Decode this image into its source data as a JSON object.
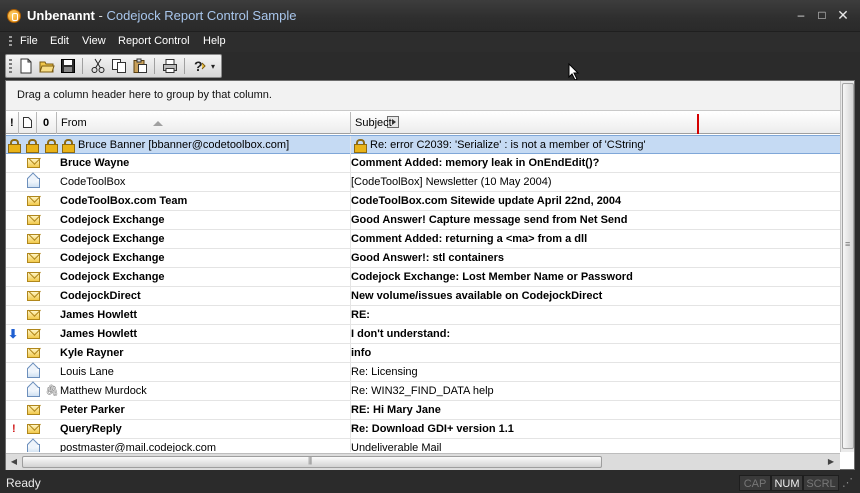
{
  "window": {
    "document_title": "Unbenannt",
    "separator": " - ",
    "app_title": "Codejock Report Control Sample",
    "min_glyph": "–",
    "max_glyph": "□",
    "close_glyph": "✕"
  },
  "menu": [
    "File",
    "Edit",
    "View",
    "Report Control",
    "Help"
  ],
  "toolbar": {
    "buttons": [
      "new-document",
      "open-folder",
      "save",
      "cut",
      "copy",
      "paste",
      "print",
      "help"
    ],
    "more_glyph": "▾"
  },
  "group_box_text": "Drag a column header here to group by that column.",
  "columns": {
    "importance": "!",
    "icon": "🗋",
    "attachment": "0",
    "from": "From",
    "subject": "Subject"
  },
  "rows": [
    {
      "from": "Bruce Banner [bbanner@codetoolbox.com]",
      "subject": "Re: error C2039: 'Serialize' : is not a member of 'CString'",
      "icon": "lock",
      "flag": "",
      "attach": false,
      "unread": false,
      "selected": true
    },
    {
      "from": "Bruce Wayne",
      "subject": "Comment Added: memory leak in OnEndEdit()?",
      "icon": "envelope",
      "flag": "",
      "attach": false,
      "unread": true,
      "selected": false
    },
    {
      "from": "CodeToolBox",
      "subject": "[CodeToolBox] Newsletter (10 May 2004)",
      "icon": "envelope-open",
      "flag": "",
      "attach": false,
      "unread": false,
      "selected": false
    },
    {
      "from": "CodeToolBox.com Team",
      "subject": "CodeToolBox.com Sitewide update April 22nd, 2004",
      "icon": "envelope",
      "flag": "",
      "attach": false,
      "unread": true,
      "selected": false
    },
    {
      "from": "Codejock Exchange",
      "subject": "Good Answer! Capture message send from Net Send",
      "icon": "envelope",
      "flag": "",
      "attach": false,
      "unread": true,
      "selected": false
    },
    {
      "from": "Codejock Exchange",
      "subject": "Comment Added: returning a <ma> from a dll",
      "icon": "envelope",
      "flag": "",
      "attach": false,
      "unread": true,
      "selected": false
    },
    {
      "from": "Codejock Exchange",
      "subject": "Good Answer!: stl containers",
      "icon": "envelope",
      "flag": "",
      "attach": false,
      "unread": true,
      "selected": false
    },
    {
      "from": "Codejock Exchange",
      "subject": "Codejock Exchange:  Lost Member Name or Password",
      "icon": "envelope",
      "flag": "",
      "attach": false,
      "unread": true,
      "selected": false
    },
    {
      "from": "CodejockDirect",
      "subject": "New volume/issues available on CodejockDirect",
      "icon": "envelope",
      "flag": "",
      "attach": false,
      "unread": true,
      "selected": false
    },
    {
      "from": "James Howlett",
      "subject": "RE:",
      "icon": "envelope",
      "flag": "",
      "attach": false,
      "unread": true,
      "selected": false
    },
    {
      "from": "James Howlett",
      "subject": "I don't understand:",
      "icon": "envelope",
      "flag": "low",
      "attach": false,
      "unread": true,
      "selected": false
    },
    {
      "from": "Kyle Rayner",
      "subject": "info",
      "icon": "envelope",
      "flag": "",
      "attach": false,
      "unread": true,
      "selected": false
    },
    {
      "from": "Louis Lane",
      "subject": "Re: Licensing",
      "icon": "envelope-open",
      "flag": "",
      "attach": false,
      "unread": false,
      "selected": false
    },
    {
      "from": "Matthew Murdock",
      "subject": "Re: WIN32_FIND_DATA help",
      "icon": "envelope-open",
      "flag": "",
      "attach": true,
      "unread": false,
      "selected": false
    },
    {
      "from": "Peter Parker",
      "subject": "RE: Hi Mary Jane",
      "icon": "envelope",
      "flag": "",
      "attach": false,
      "unread": true,
      "selected": false
    },
    {
      "from": "QueryReply",
      "subject": "Re: Download GDI+ version 1.1",
      "icon": "envelope",
      "flag": "high",
      "attach": false,
      "unread": true,
      "selected": false
    },
    {
      "from": "postmaster@mail.codejock.com",
      "subject": "Undeliverable Mail",
      "icon": "envelope-open",
      "flag": "",
      "attach": false,
      "unread": false,
      "selected": false
    }
  ],
  "status": {
    "text": "Ready",
    "indicators": [
      {
        "label": "CAP",
        "active": false
      },
      {
        "label": "NUM",
        "active": true
      },
      {
        "label": "SCRL",
        "active": false
      }
    ]
  },
  "colors": {
    "selection": "#c5daf3",
    "resize_marker": "#d40000",
    "frame": "#2b2b2b"
  }
}
